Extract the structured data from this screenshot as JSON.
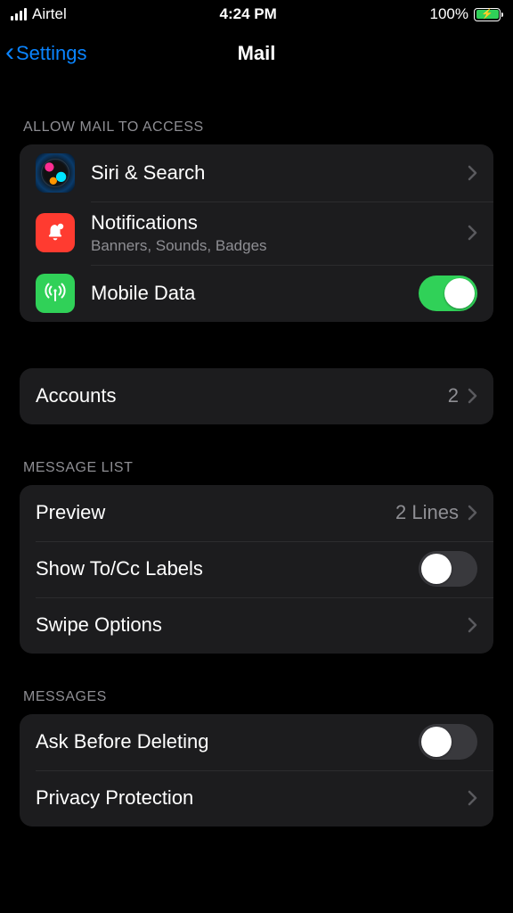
{
  "status": {
    "carrier": "Airtel",
    "time": "4:24 PM",
    "battery_pct": "100%"
  },
  "nav": {
    "back": "Settings",
    "title": "Mail"
  },
  "sections": {
    "access": {
      "header": "Allow Mail to Access",
      "siri": "Siri & Search",
      "notifications": {
        "title": "Notifications",
        "subtitle": "Banners, Sounds, Badges"
      },
      "mobile_data": {
        "title": "Mobile Data",
        "on": true
      }
    },
    "accounts": {
      "title": "Accounts",
      "count": "2"
    },
    "message_list": {
      "header": "Message List",
      "preview": {
        "title": "Preview",
        "value": "2 Lines"
      },
      "show_tocc": {
        "title": "Show To/Cc Labels",
        "on": false
      },
      "swipe": "Swipe Options"
    },
    "messages": {
      "header": "Messages",
      "ask_delete": {
        "title": "Ask Before Deleting",
        "on": false
      },
      "privacy": "Privacy Protection"
    }
  }
}
